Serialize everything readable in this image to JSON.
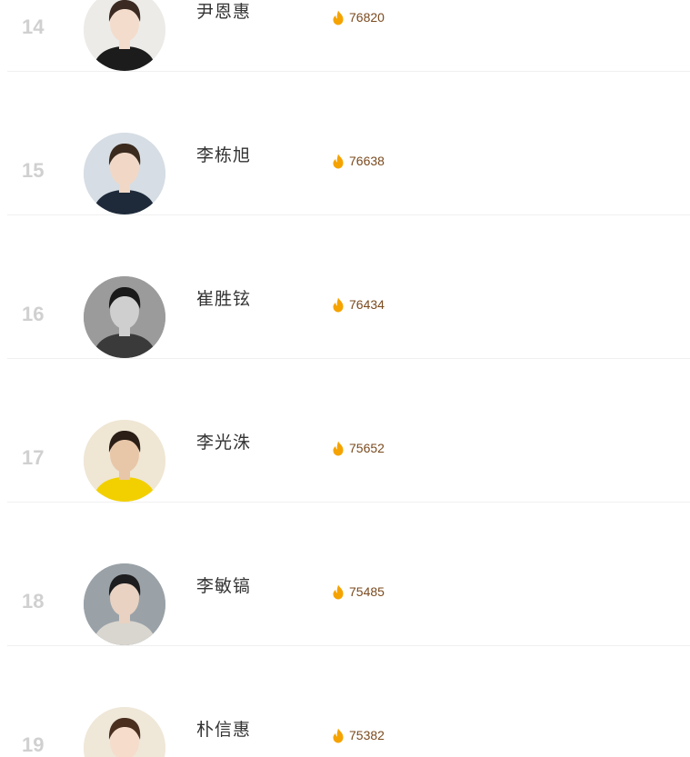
{
  "ranking": {
    "colors": {
      "rank": "#d0d0d0",
      "name": "#333333",
      "heat_value": "#7a4a1e",
      "flame": "#f5a300",
      "divider": "#f0f0f0"
    },
    "heat_icon": "flame-icon",
    "items": [
      {
        "rank": "14",
        "name": "尹恩惠",
        "heat": "76820",
        "avatar": {
          "bg": "#ecebe8",
          "hair": "#3a2a22",
          "skin": "#f3dccc",
          "cloth": "#1c1c1c"
        }
      },
      {
        "rank": "15",
        "name": "李栋旭",
        "heat": "76638",
        "avatar": {
          "bg": "#d6dde4",
          "hair": "#3b2b1f",
          "skin": "#f1d8c6",
          "cloth": "#1e2a3a"
        }
      },
      {
        "rank": "16",
        "name": "崔胜铉",
        "heat": "76434",
        "avatar": {
          "bg": "#9b9b9b",
          "hair": "#1a1a1a",
          "skin": "#cfcfcf",
          "cloth": "#3a3a3a"
        }
      },
      {
        "rank": "17",
        "name": "李光洙",
        "heat": "75652",
        "avatar": {
          "bg": "#efe6d4",
          "hair": "#2a1e16",
          "skin": "#e8c6a8",
          "cloth": "#f2d000"
        }
      },
      {
        "rank": "18",
        "name": "李敏镐",
        "heat": "75485",
        "avatar": {
          "bg": "#9aa2a8",
          "hair": "#1d1d1f",
          "skin": "#e9d2c2",
          "cloth": "#d9d6cf"
        }
      },
      {
        "rank": "19",
        "name": "朴信惠",
        "heat": "75382",
        "avatar": {
          "bg": "#efe7d8",
          "hair": "#4a2f1f",
          "skin": "#f5dccb",
          "cloth": "#e7e0d2"
        }
      }
    ]
  }
}
